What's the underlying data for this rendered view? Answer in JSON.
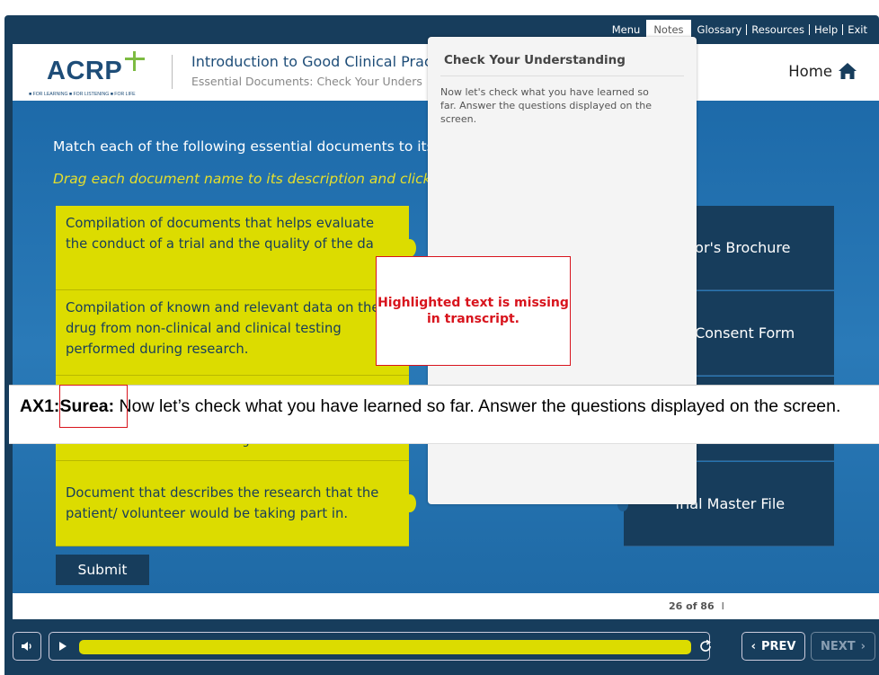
{
  "topnav": {
    "items": [
      "Menu",
      "Notes",
      "Glossary",
      "Resources",
      "Help",
      "Exit"
    ]
  },
  "header": {
    "logo_text": "ACRP",
    "logo_tagline": "■ FOR LEARNING ■ FOR LISTENING ■ FOR LIFE",
    "course_title": "Introduction to Good Clinical Pract",
    "course_subtitle": "Essential Documents: Check Your Unders",
    "home_label": "Home"
  },
  "stage": {
    "instruction": "Match each of the following essential documents to its",
    "instruction2": "Drag each document name to its description and click",
    "descriptions": [
      "Compilation of documents that helps evaluate the conduct of a trial and the quality of the da",
      "Compilation of known and relevant data on the drug from non-clinical and clinical testing performed during research.",
      "behavior to be executed during a trial.",
      "Document that describes the research that the patient/ volunteer would be taking part in."
    ],
    "documents": [
      "igator's Brochure",
      "ned Consent Form",
      "",
      "Trial Master File"
    ],
    "submit_label": "Submit"
  },
  "footer": {
    "page_count": "26 of 86",
    "divider": "I"
  },
  "controls": {
    "prev_label": "PREV",
    "next_label": "NEXT"
  },
  "notes": {
    "title": "Check Your Understanding",
    "body": "Now let's check what you have learned so far. Answer the questions displayed on the screen."
  },
  "annotation": {
    "text": "Highlighted text is missing in transcript."
  },
  "transcript": {
    "prefix": "AX1:",
    "speaker": "Surea:",
    "text": " Now let’s check what you have learned so far. Answer the questions displayed on the screen."
  },
  "colors": {
    "navy": "#173d5c",
    "accent_yellow": "#dcdc00",
    "stage_blue": "#1f6aa6",
    "annotation_red": "#d8141d"
  }
}
